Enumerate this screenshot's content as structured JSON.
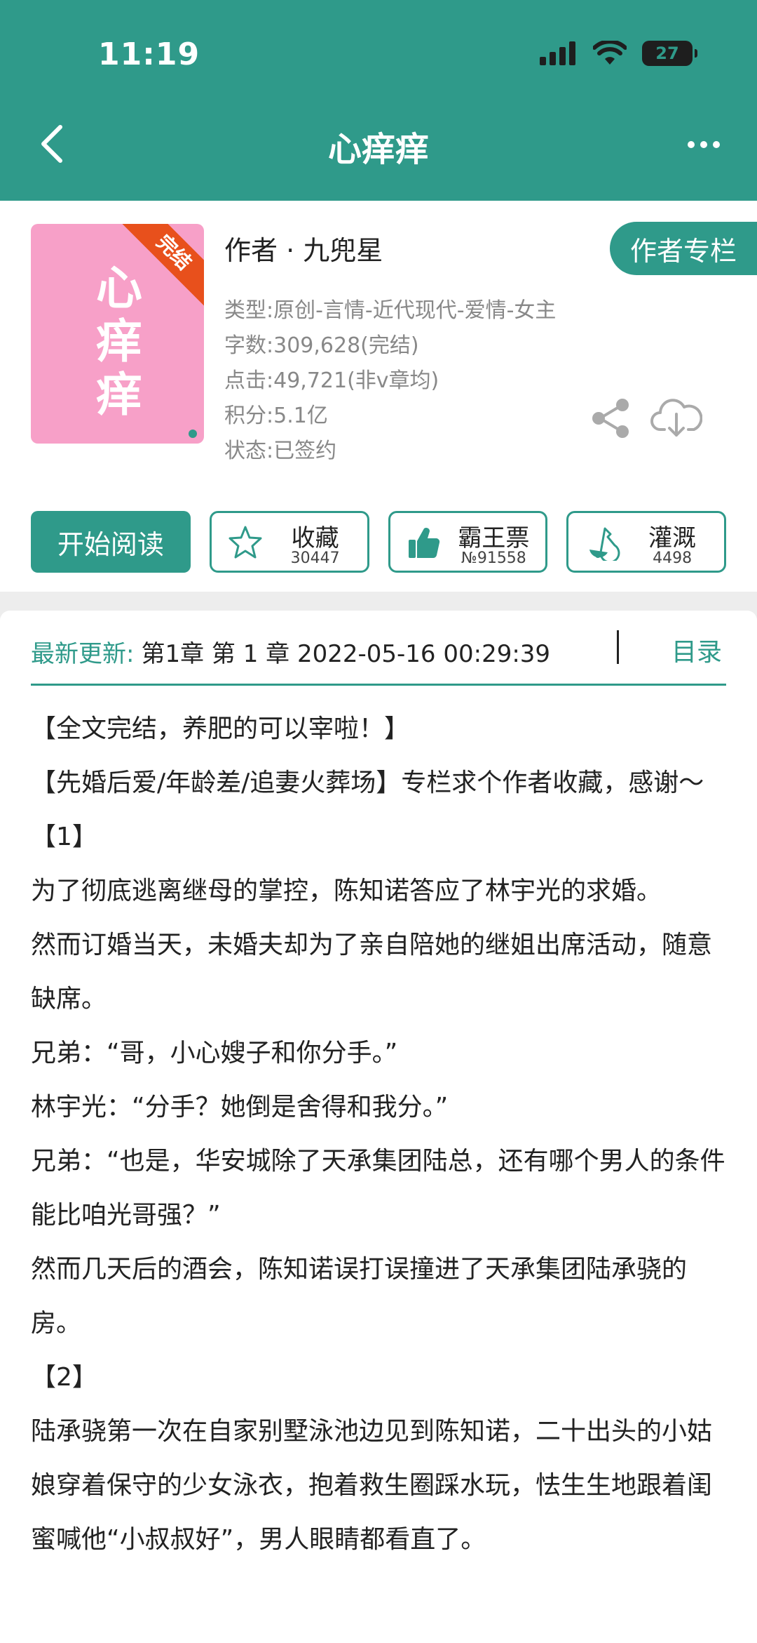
{
  "status_bar": {
    "time": "11:19",
    "battery": "27"
  },
  "header": {
    "title": "心痒痒"
  },
  "book": {
    "cover_title": "心痒痒",
    "badge": "完结",
    "author": "作者 · 九兜星",
    "column_button": "作者专栏",
    "meta": [
      "类型:原创-言情-近代现代-爱情-女主",
      "字数:309,628(完结)",
      "点击:49,721(非v章均)",
      "积分:5.1亿",
      "状态:已签约"
    ]
  },
  "actions": {
    "read": "开始阅读",
    "collect": {
      "label": "收藏",
      "count": "30447"
    },
    "vote": {
      "label": "霸王票",
      "count": "№91558"
    },
    "water": {
      "label": "灌溉",
      "count": "4498"
    }
  },
  "content": {
    "latest_label": "最新更新:",
    "latest_value": "第1章 第 1 章 2022-05-16 00:29:39",
    "catalog": "目录",
    "paragraphs": [
      "【全文完结，养肥的可以宰啦！】",
      "【先婚后爱/年龄差/追妻火葬场】专栏求个作者收藏，感谢～",
      "【1】",
      "为了彻底逃离继母的掌控，陈知诺答应了林宇光的求婚。",
      "然而订婚当天，未婚夫却为了亲自陪她的继姐出席活动，随意缺席。",
      "兄弟：“哥，小心嫂子和你分手。”",
      "林宇光：“分手？她倒是舍得和我分。”",
      "兄弟：“也是，华安城除了天承集团陆总，还有哪个男人的条件能比咱光哥强？”",
      "然而几天后的酒会，陈知诺误打误撞进了天承集团陆承骁的房。",
      "【2】",
      "陆承骁第一次在自家别墅泳池边见到陈知诺，二十出头的小姑娘穿着保守的少女泳衣，抱着救生圈踩水玩，怯生生地跟着闺蜜喊他“小叔叔好”，男人眼睛都看直了。"
    ]
  }
}
